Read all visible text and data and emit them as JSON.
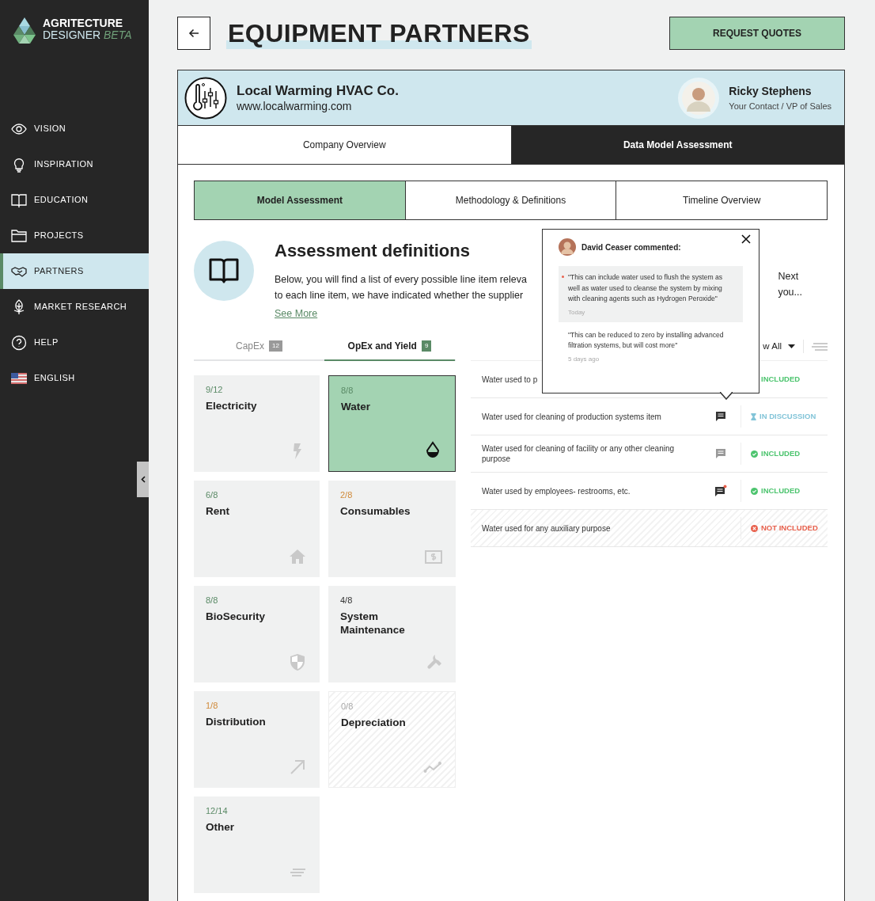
{
  "brand": {
    "line1": "AGRITECTURE",
    "line2": "DESIGNER",
    "badge": "BETA"
  },
  "sidebar": {
    "items": [
      {
        "label": "VISION",
        "selected": false
      },
      {
        "label": "INSPIRATION",
        "selected": false
      },
      {
        "label": "EDUCATION",
        "selected": false
      },
      {
        "label": "PROJECTS",
        "selected": false
      },
      {
        "label": "PARTNERS",
        "selected": true
      },
      {
        "label": "MARKET RESEARCH",
        "selected": false
      },
      {
        "label": "HELP",
        "selected": false
      },
      {
        "label": "ENGLISH",
        "selected": false
      }
    ]
  },
  "header": {
    "title": "EQUIPMENT PARTNERS",
    "action": "REQUEST QUOTES"
  },
  "vendor": {
    "name": "Local Warming HVAC Co.",
    "url": "www.localwarming.com",
    "contact_name": "Ricky Stephens",
    "contact_role": "Your Contact / VP of Sales"
  },
  "tabs": [
    {
      "label": "Company Overview",
      "selected": false
    },
    {
      "label": "Data Model Assessment",
      "selected": true
    }
  ],
  "subtabs": [
    {
      "label": "Model Assessment",
      "selected": true
    },
    {
      "label": "Methodology & Definitions",
      "selected": false
    },
    {
      "label": "Timeline Overview",
      "selected": false
    }
  ],
  "intro": {
    "title": "Assessment definitions",
    "lines_left": [
      "Below, you will find a list of every possible line item releva",
      "to each line item, we have indicated whether the supplier"
    ],
    "lines_right": [
      "Next",
      "you..."
    ],
    "link": "See More"
  },
  "cost_tabs": [
    {
      "label": "CapEx",
      "count": "12",
      "selected": false
    },
    {
      "label": "OpEx and Yield",
      "count": "9",
      "selected": true
    }
  ],
  "tiles": [
    {
      "count": "9/12",
      "label": "Electricity",
      "color": "#5a8a66",
      "selected": false,
      "disabled": false
    },
    {
      "count": "8/8",
      "label": "Water",
      "color": "#5a8a66",
      "selected": true,
      "disabled": false
    },
    {
      "count": "6/8",
      "label": "Rent",
      "color": "#5a8a66",
      "selected": false,
      "disabled": false
    },
    {
      "count": "2/8",
      "label": "Consumables",
      "color": "#d08a3a",
      "selected": false,
      "disabled": false
    },
    {
      "count": "8/8",
      "label": "BioSecurity",
      "color": "#5a8a66",
      "selected": false,
      "disabled": false
    },
    {
      "count": "4/8",
      "label": "System Maintenance",
      "color": "#333333",
      "selected": false,
      "disabled": false
    },
    {
      "count": "1/8",
      "label": "Distribution",
      "color": "#d08a3a",
      "selected": false,
      "disabled": false
    },
    {
      "count": "0/8",
      "label": "Depreciation",
      "color": "#aaaaaa",
      "selected": false,
      "disabled": true
    },
    {
      "count": "12/14",
      "label": "Other",
      "color": "#5a8a66",
      "selected": false,
      "disabled": false
    }
  ],
  "filter": {
    "label": "w All"
  },
  "rows": [
    {
      "text": "Water used to p",
      "kind": "included",
      "status_label": "INCLUDED"
    },
    {
      "text": "Water used for cleaning of production systems item",
      "comment": {
        "kind": "active"
      },
      "kind": "in_discussion",
      "status_label": "IN DISCUSSION"
    },
    {
      "text": "Water used for cleaning of facility or any other cleaning purpose",
      "comment": {
        "kind": "read"
      },
      "kind": "included",
      "status_label": "INCLUDED"
    },
    {
      "text": "Water used by employees- restrooms, etc.",
      "comment": {
        "kind": "unread"
      },
      "kind": "included",
      "status_label": "INCLUDED"
    },
    {
      "text": "Water used for any auxiliary purpose",
      "kind": "not_included",
      "status_label": "NOT INCLUDED"
    }
  ],
  "popover": {
    "author": "David Ceaser commented:",
    "comments": [
      {
        "text": "\"This can include water used to flush the system as well as water used to cleanse the system by mixing with cleaning agents such as Hydrogen Peroxide\"",
        "time": "Today",
        "unread": true
      },
      {
        "text": "\"This can be reduced to zero by installing advanced filtration systems, but will cost more\"",
        "time": "5 days ago",
        "unread": false
      }
    ]
  }
}
